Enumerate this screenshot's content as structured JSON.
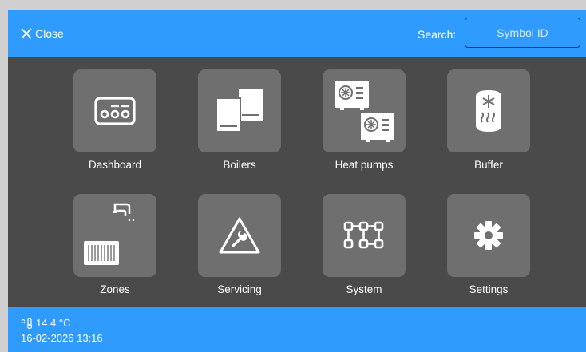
{
  "header": {
    "close_label": "Close",
    "search_label": "Search:",
    "search_placeholder": "Symbol ID",
    "search_value": ""
  },
  "tiles": [
    {
      "label": "Dashboard",
      "icon": "dashboard-icon"
    },
    {
      "label": "Boilers",
      "icon": "boilers-icon"
    },
    {
      "label": "Heat pumps",
      "icon": "heat-pumps-icon"
    },
    {
      "label": "Buffer",
      "icon": "buffer-icon"
    },
    {
      "label": "Zones",
      "icon": "zones-icon"
    },
    {
      "label": "Servicing",
      "icon": "servicing-icon"
    },
    {
      "label": "System",
      "icon": "system-icon"
    },
    {
      "label": "Settings",
      "icon": "settings-icon"
    }
  ],
  "status": {
    "temperature": "14.4 °C",
    "datetime": "16-02-2026 13:16",
    "temperature_icon": "thermometer-icon"
  },
  "colors": {
    "accent": "#2f9bff",
    "background": "#4a4a4a",
    "tile": "#6f6f6f"
  }
}
